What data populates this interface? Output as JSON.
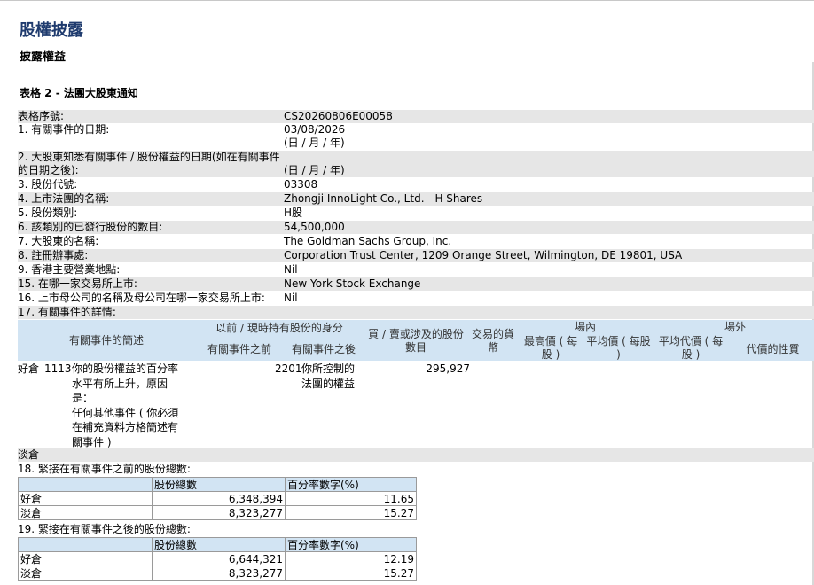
{
  "page": {
    "title": "股權披露",
    "subtitle": "披露權益",
    "table_caption": "表格 2 - 法團大股東通知"
  },
  "fields": [
    {
      "label": "表格序號:",
      "value": "CS20260806E00058"
    },
    {
      "label": "1. 有關事件的日期:",
      "value": "03/08/2026",
      "value2": "(日 / 月 / 年)"
    },
    {
      "label": "2. 大股東知悉有關事件 / 股份權益的日期(如在有關事件",
      "label2": "的日期之後):",
      "value2": "(日 / 月 / 年)"
    },
    {
      "label": "3. 股份代號:",
      "value": "03308"
    },
    {
      "label": "4. 上市法團的名稱:",
      "value": "Zhongji InnoLight Co., Ltd. - H Shares"
    },
    {
      "label": "5. 股份類別:",
      "value": "H股"
    },
    {
      "label": "6. 該類別的已發行股份的數目:",
      "value": "54,500,000"
    },
    {
      "label": "7. 大股東的名稱:",
      "value": "The Goldman Sachs Group, Inc."
    },
    {
      "label": "8. 註冊辦事處:",
      "value": "Corporation Trust Center, 1209 Orange Street, Wilmington, DE 19801, USA"
    },
    {
      "label": "9. 香港主要營業地點:",
      "value": "Nil"
    },
    {
      "label": "15. 在哪一家交易所上市:",
      "value": "New York Stock Exchange"
    },
    {
      "label": "16. 上市母公司的名稱及母公司在哪一家交易所上市:",
      "value": "Nil"
    },
    {
      "label": "17. 有關事件的詳情:"
    }
  ],
  "event_table": {
    "headers": {
      "desc": "有關事件的簡述",
      "capacity": "以前 / 現時持有股份的身分",
      "before": "有關事件之前",
      "after": "有關事件之後",
      "shares": "買 / 賣或涉及的股份數目",
      "currency": "交易的貨幣",
      "on_exchange": "場內",
      "high": "最高價 ( 每股 )",
      "avg": "平均價 ( 每股 )",
      "off_exchange": "場外",
      "avg_off": "平均代價 ( 每股 )",
      "consideration": "代價的性質"
    },
    "row": {
      "position": "好倉",
      "code": "1113",
      "desc_lines": [
        "你的股份權益的百分率",
        "水平有所上升，原因",
        "是：",
        "任何其他事件 ( 你必須",
        "在補充資料方格簡述有",
        "關事件 )"
      ],
      "code_after": "2201",
      "after_lines": [
        "你所控制的",
        "法團的權益"
      ],
      "shares": "295,927"
    },
    "short_label": "淡倉"
  },
  "section18": {
    "title": "18. 緊接在有關事件之前的股份總數:",
    "col1": "股份總數",
    "col2": "百分率數字(%)",
    "rows": [
      {
        "label": "好倉",
        "shares": "6,348,394",
        "pct": "11.65"
      },
      {
        "label": "淡倉",
        "shares": "8,323,277",
        "pct": "15.27"
      }
    ]
  },
  "section19": {
    "title": "19. 緊接在有關事件之後的股份總數:",
    "col1": "股份總數",
    "col2": "百分率數字(%)",
    "rows": [
      {
        "label": "好倉",
        "shares": "6,644,321",
        "pct": "12.19"
      },
      {
        "label": "淡倉",
        "shares": "8,323,277",
        "pct": "15.27"
      }
    ]
  }
}
